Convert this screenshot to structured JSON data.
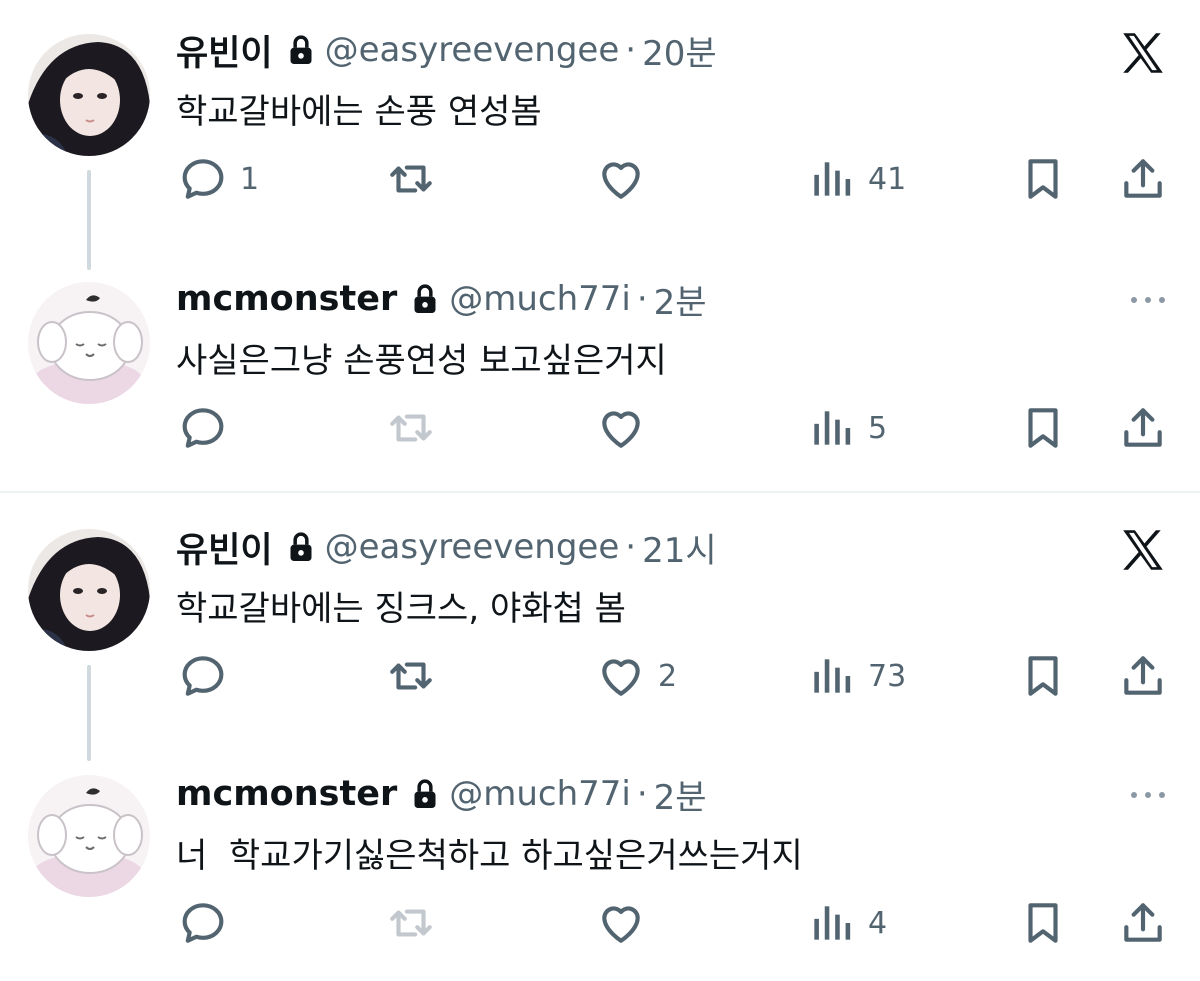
{
  "colors": {
    "text": "#0f1419",
    "secondary": "#536471",
    "line": "#cfd9de",
    "divider": "#eff3f4"
  },
  "groups": [
    {
      "source": {
        "name": "유빈이",
        "handle": "@easyreevengee",
        "dot": "·",
        "time": "20분",
        "text": "학교갈바에는 손풍 연성봄",
        "replies": "1",
        "retweets": "",
        "likes": "",
        "views": "41",
        "logo_icon": "x-logo-icon"
      },
      "reply": {
        "name": "mcmonster",
        "handle": "@much77i",
        "dot": "·",
        "time": "2분",
        "text": "사실은그냥 손풍연성 보고싶은거지",
        "replies": "",
        "retweets": "",
        "likes": "",
        "views": "5",
        "more_icon": "more-icon"
      }
    },
    {
      "source": {
        "name": "유빈이",
        "handle": "@easyreevengee",
        "dot": "·",
        "time": "21시",
        "text": "학교갈바에는 징크스, 야화첩 봄",
        "replies": "",
        "retweets": "",
        "likes": "2",
        "views": "73",
        "logo_icon": "x-logo-icon"
      },
      "reply": {
        "name": "mcmonster",
        "handle": "@much77i",
        "dot": "·",
        "time": "2분",
        "text": "너  학교가기싫은척하고 하고싶은거쓰는거지",
        "replies": "",
        "retweets": "",
        "likes": "",
        "views": "4",
        "more_icon": "more-icon"
      }
    }
  ]
}
